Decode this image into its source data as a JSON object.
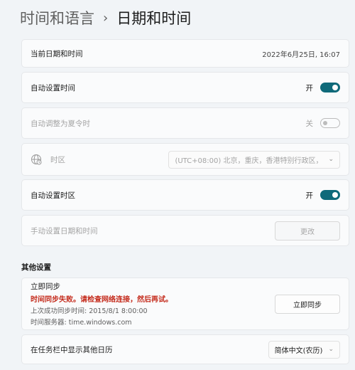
{
  "breadcrumb": {
    "parent": "时间和语言",
    "separator": "›",
    "current": "日期和时间"
  },
  "current_datetime": {
    "label": "当前日期和时间",
    "value": "2022年6月25日, 16:07"
  },
  "auto_time": {
    "label": "自动设置时间",
    "state_text": "开",
    "enabled": true
  },
  "dst": {
    "label": "自动调整为夏令时",
    "state_text": "关",
    "enabled": false
  },
  "timezone": {
    "icon": "globe-icon",
    "label": "时区",
    "value": "(UTC+08:00) 北京，重庆，香港特别行政区，"
  },
  "auto_timezone": {
    "label": "自动设置时区",
    "state_text": "开",
    "enabled": true
  },
  "manual_set": {
    "label": "手动设置日期和时间",
    "button": "更改"
  },
  "other_settings": {
    "title": "其他设置"
  },
  "sync": {
    "title": "立即同步",
    "error": "时间同步失败。请检查网络连接，然后再试。",
    "last_sync": "上次成功同步时间: 2015/8/1 8:00:00",
    "server": "时间服务器: time.windows.com",
    "button": "立即同步"
  },
  "calendar": {
    "label": "在任务栏中显示其他日历",
    "value": "简体中文(农历)"
  },
  "colors": {
    "accent": "#0f6a7a",
    "error": "#c42b1c"
  }
}
